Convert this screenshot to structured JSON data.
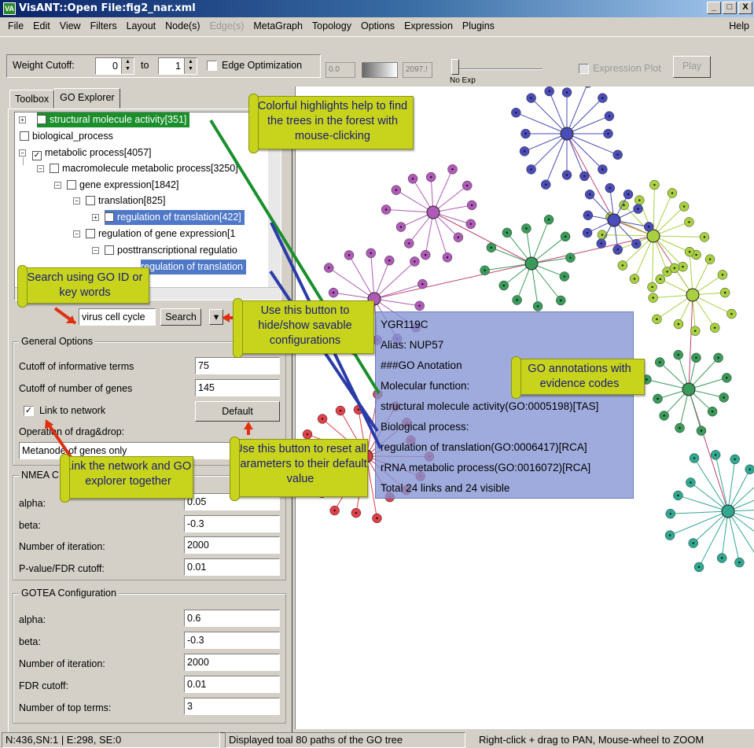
{
  "window": {
    "app_icon": "VA",
    "title": "VisANT::Open File:fig2_nar.xml",
    "buttons": [
      "_",
      "□",
      "X"
    ]
  },
  "menu": [
    "File",
    "Edit",
    "View",
    "Filters",
    "Layout",
    "Node(s)",
    "Edge(s)",
    "MetaGraph",
    "Topology",
    "Options",
    "Expression",
    "Plugins"
  ],
  "menu_disabled": [
    "Edge(s)"
  ],
  "menu_help": "Help",
  "toolbar": {
    "weight_cutoff_label": "Weight Cutoff:",
    "from_value": "0",
    "to_label": "to",
    "to_value": "1",
    "edge_optimization_label": "Edge Optimization",
    "exp_min": "0.0",
    "exp_max": "2097.!",
    "no_exp_label": "No Exp",
    "expression_plot_label": "Expression Plot",
    "play_label": "Play"
  },
  "tabs": [
    {
      "label": "Toolbox"
    },
    {
      "label": "GO Explorer"
    }
  ],
  "tree": [
    {
      "label": "structural molecule activity[351]",
      "checked": false,
      "highlight": "green"
    },
    {
      "label": "biological_process",
      "checked": false
    },
    {
      "label": "metabolic process[4057]",
      "checked": true
    },
    {
      "label": "macromolecule metabolic process[3250]",
      "checked": false
    },
    {
      "label": "gene expression[1842]",
      "checked": false
    },
    {
      "label": "translation[825]",
      "checked": false
    },
    {
      "label": "regulation of translation[422]",
      "checked": false,
      "highlight": "blue"
    },
    {
      "label": "regulation of gene expression[1",
      "checked": false
    },
    {
      "label": "posttranscriptional regulatio",
      "checked": false
    },
    {
      "label": "regulation of translation",
      "checked": false,
      "highlight": "blue"
    }
  ],
  "search": {
    "value": "virus cell cycle",
    "button": "Search",
    "menu_glyph": "▾"
  },
  "general_options": {
    "title": "General Options",
    "informative_label": "Cutoff of informative terms",
    "informative_value": "75",
    "genes_label": "Cutoff of number of genes",
    "genes_value": "145",
    "link_label": "Link to network",
    "link_checked": true,
    "default_button": "Default",
    "drag_label": "Operation of drag&drop:",
    "drag_value": "Metanode of genes only"
  },
  "nmea": {
    "title": "NMEA C",
    "alpha_label": "alpha:",
    "alpha_value": "0.05",
    "beta_label": "beta:",
    "beta_value": "-0.3",
    "iter_label": "Number of iteration:",
    "iter_value": "2000",
    "pvalue_label": "P-value/FDR cutoff:",
    "pvalue_value": "0.01"
  },
  "gotea": {
    "title": "GOTEA Configuration",
    "alpha_label": "alpha:",
    "alpha_value": "0.6",
    "beta_label": "beta:",
    "beta_value": "-0.3",
    "iter_label": "Number of iteration:",
    "iter_value": "2000",
    "fdr_label": "FDR cutoff:",
    "fdr_value": "0.01",
    "top_label": "Number of top terms:",
    "top_value": "3"
  },
  "infobox": [
    "YGR119C",
    "Alias: NUP57",
    "###GO Anotation",
    "Molecular function:",
    "structural molecule activity(GO:0005198)[TAS]",
    "Biological process:",
    "regulation of translation(GO:0006417)[RCA]",
    "rRNA metabolic process(GO:0016072)[RCA]",
    "Total 24 links and 24 visible"
  ],
  "annotations": {
    "colorful": "Colorful highlights help to find the trees in the forest with mouse-clicking",
    "search": "Search using GO ID or key words",
    "hide_show": "Use this button to hide/show savable configurations",
    "go_annot": "GO annotations with evidence codes",
    "link": "Link the network and GO explorer together",
    "reset": "Use this button to reset all parameters to their default value"
  },
  "status": {
    "counts": "N:436,SN:1 | E:298, SE:0",
    "message": "Displayed toal 80 paths of the GO tree",
    "hint": "Right-click + drag to PAN, Mouse-wheel to ZOOM"
  },
  "colors": {
    "title_bar": "#0a246a",
    "highlight_green": "#1a8f2c",
    "highlight_blue": "#4f78c8",
    "annotation": "#c8d41c",
    "node_purple": "#b05ab8",
    "node_blue": "#4a4cb8",
    "node_green": "#3a9a5a",
    "node_lime": "#a8d040",
    "node_red": "#e04048",
    "node_teal": "#30a890"
  }
}
